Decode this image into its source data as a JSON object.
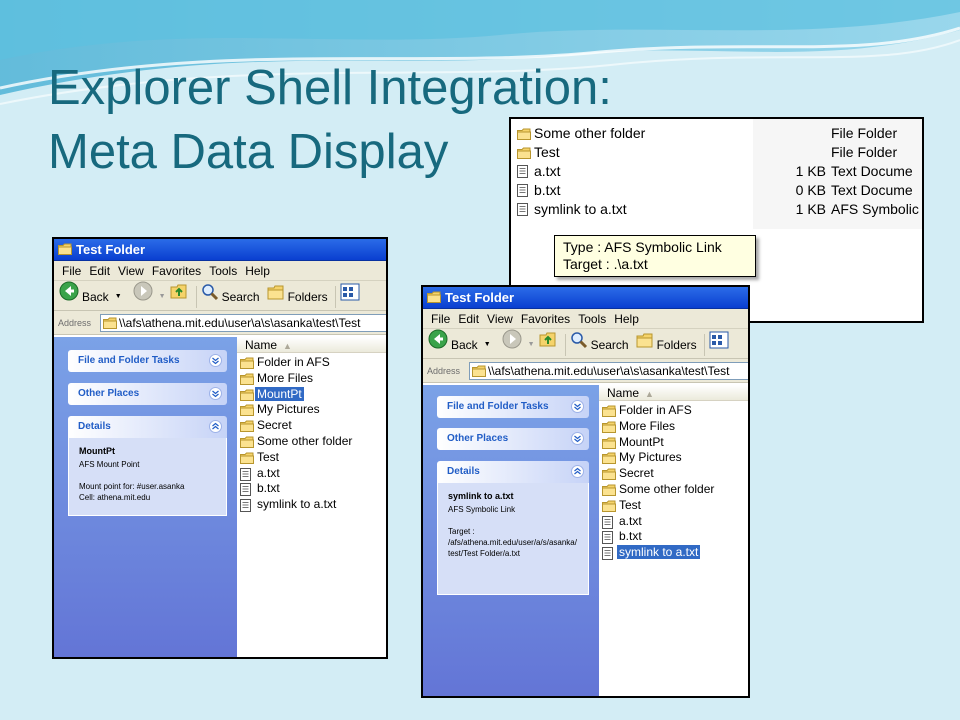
{
  "slide": {
    "title_line1": "Explorer Shell Integration:",
    "title_line2": "Meta Data Display"
  },
  "colors": {
    "title": "#17697e",
    "background": "#d3edf5",
    "xp_titlebar": "#0a3fd0",
    "selection": "#316ac5",
    "tooltip_bg": "#ffffe1"
  },
  "detail_view": {
    "rows": [
      {
        "name": "Some other folder",
        "size": "",
        "type": "File Folder",
        "icon": "folder-icon"
      },
      {
        "name": "Test",
        "size": "",
        "type": "File Folder",
        "icon": "folder-icon"
      },
      {
        "name": "a.txt",
        "size": "1 KB",
        "type": "Text Docume",
        "icon": "text-file-icon"
      },
      {
        "name": "b.txt",
        "size": "0 KB",
        "type": "Text Docume",
        "icon": "text-file-icon"
      },
      {
        "name": "symlink to a.txt",
        "size": "1 KB",
        "type": "AFS Symbolic",
        "icon": "text-file-icon"
      }
    ],
    "tooltip": {
      "line1": "Type : AFS Symbolic Link",
      "line2": "Target : .\\a.txt"
    }
  },
  "explorer_windows": [
    {
      "title": "Test Folder",
      "menu": [
        "File",
        "Edit",
        "View",
        "Favorites",
        "Tools",
        "Help"
      ],
      "toolbar": {
        "back": "Back",
        "search": "Search",
        "folders": "Folders"
      },
      "address_label": "Address",
      "address": "\\\\afs\\athena.mit.edu\\user\\a\\s\\asanka\\test\\Test",
      "tasks": {
        "file_folder_tasks": "File and Folder Tasks",
        "other_places": "Other Places",
        "details": "Details",
        "details_title": "MountPt",
        "details_line1": "AFS Mount Point",
        "details_line2": "Mount point for: #user.asanka",
        "details_line3": "Cell: athena.mit.edu"
      },
      "name_header": "Name",
      "files": [
        {
          "name": "Folder in AFS",
          "icon": "folder-icon",
          "selected": false
        },
        {
          "name": "More Files",
          "icon": "folder-icon",
          "selected": false
        },
        {
          "name": "MountPt",
          "icon": "folder-icon",
          "selected": true
        },
        {
          "name": "My Pictures",
          "icon": "folder-icon",
          "selected": false
        },
        {
          "name": "Secret",
          "icon": "folder-icon",
          "selected": false
        },
        {
          "name": "Some other folder",
          "icon": "folder-icon",
          "selected": false
        },
        {
          "name": "Test",
          "icon": "folder-icon",
          "selected": false
        },
        {
          "name": "a.txt",
          "icon": "text-file-icon",
          "selected": false
        },
        {
          "name": "b.txt",
          "icon": "text-file-icon",
          "selected": false
        },
        {
          "name": "symlink to a.txt",
          "icon": "text-file-icon",
          "selected": false
        }
      ]
    },
    {
      "title": "Test Folder",
      "menu": [
        "File",
        "Edit",
        "View",
        "Favorites",
        "Tools",
        "Help"
      ],
      "toolbar": {
        "back": "Back",
        "search": "Search",
        "folders": "Folders"
      },
      "address_label": "Address",
      "address": "\\\\afs\\athena.mit.edu\\user\\a\\s\\asanka\\test\\Test",
      "tasks": {
        "file_folder_tasks": "File and Folder Tasks",
        "other_places": "Other Places",
        "details": "Details",
        "details_title": "symlink to a.txt",
        "details_line1": "AFS Symbolic Link",
        "details_line2": "Target :",
        "details_line3": "/afs/athena.mit.edu/user/a/s/asanka/test/Test Folder/a.txt"
      },
      "name_header": "Name",
      "files": [
        {
          "name": "Folder in AFS",
          "icon": "folder-icon",
          "selected": false
        },
        {
          "name": "More Files",
          "icon": "folder-icon",
          "selected": false
        },
        {
          "name": "MountPt",
          "icon": "folder-icon",
          "selected": false
        },
        {
          "name": "My Pictures",
          "icon": "folder-icon",
          "selected": false
        },
        {
          "name": "Secret",
          "icon": "folder-icon",
          "selected": false
        },
        {
          "name": "Some other folder",
          "icon": "folder-icon",
          "selected": false
        },
        {
          "name": "Test",
          "icon": "folder-icon",
          "selected": false
        },
        {
          "name": "a.txt",
          "icon": "text-file-icon",
          "selected": false
        },
        {
          "name": "b.txt",
          "icon": "text-file-icon",
          "selected": false
        },
        {
          "name": "symlink to a.txt",
          "icon": "text-file-icon",
          "selected": true
        }
      ]
    }
  ]
}
